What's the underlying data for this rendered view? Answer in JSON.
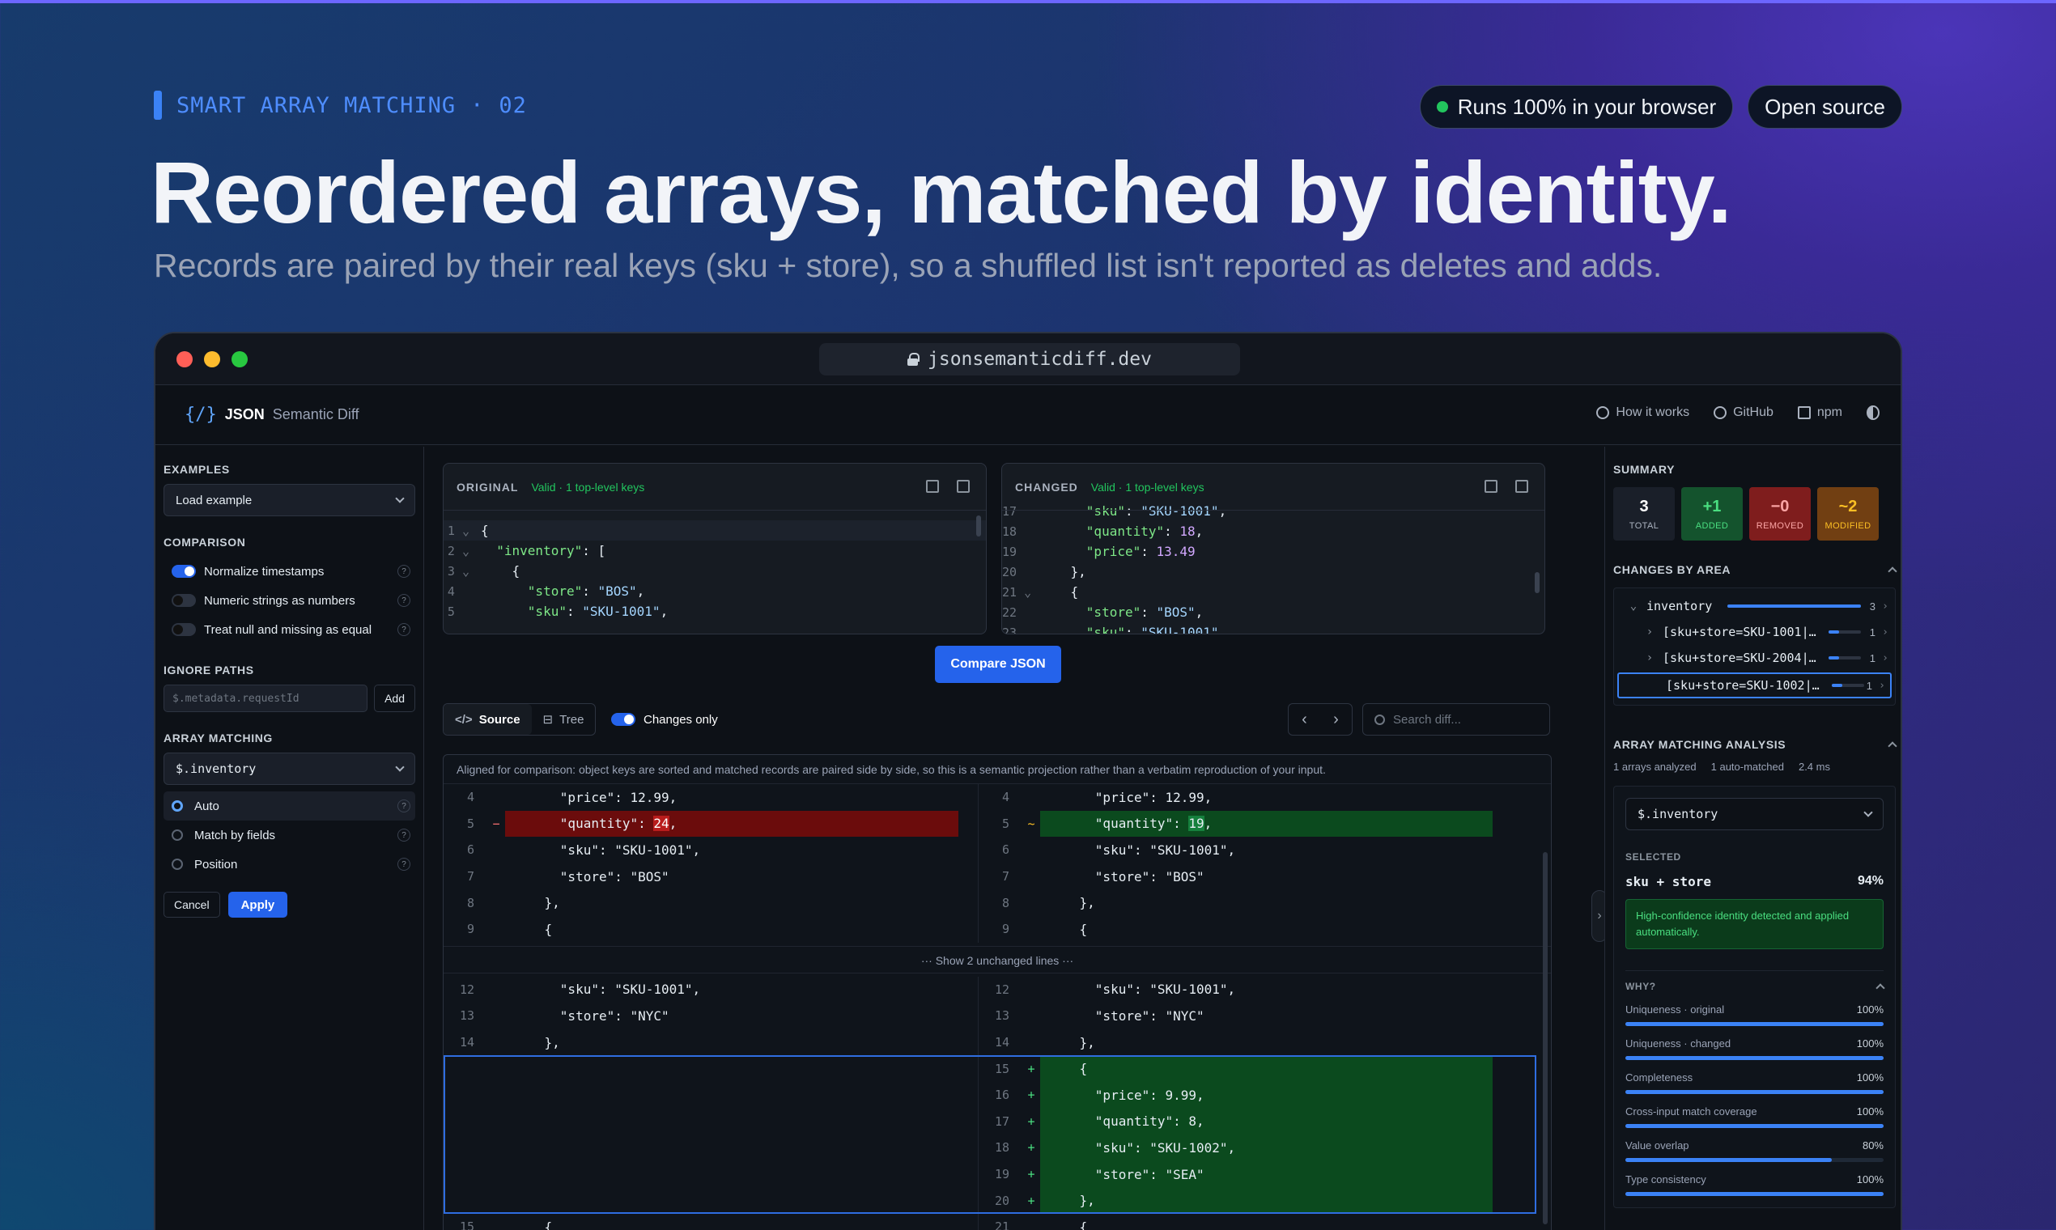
{
  "hero": {
    "eyebrow": "SMART ARRAY MATCHING",
    "eyebrow_sep": "·",
    "eyebrow_num": "02",
    "pill_browser": "Runs 100% in your browser",
    "pill_open": "Open source",
    "title": "Reordered arrays, matched by identity.",
    "subtitle": "Records are paired by their real keys (sku + store), so a shuffled list isn't reported as deletes and adds."
  },
  "window": {
    "url": "jsonsemanticdiff.dev"
  },
  "app": {
    "brand_bracket": "{/}",
    "brand_bold": "JSON",
    "brand_rest": "Semantic Diff",
    "nav": {
      "how": "How it works",
      "github": "GitHub",
      "npm": "npm"
    }
  },
  "sidebar": {
    "examples_label": "EXAMPLES",
    "examples_value": "Load example",
    "comparison_label": "COMPARISON",
    "toggles": [
      {
        "label": "Normalize timestamps",
        "on": true
      },
      {
        "label": "Numeric strings as numbers",
        "on": false
      },
      {
        "label": "Treat null and missing as equal",
        "on": false
      }
    ],
    "help": "?",
    "ignore_label": "IGNORE PATHS",
    "ignore_placeholder": "$.metadata.requestId",
    "add_label": "Add",
    "array_label": "ARRAY MATCHING",
    "array_value": "$.inventory",
    "radios": [
      {
        "label": "Auto",
        "selected": true
      },
      {
        "label": "Match by fields",
        "selected": false
      },
      {
        "label": "Position",
        "selected": false
      }
    ],
    "cancel": "Cancel",
    "apply": "Apply"
  },
  "editors": {
    "original": {
      "label": "ORIGINAL",
      "status": "Valid · 1 top-level keys",
      "lines": [
        {
          "n": "1",
          "fold": true,
          "t": "{"
        },
        {
          "n": "2",
          "fold": true,
          "t": "  \"inventory\": ["
        },
        {
          "n": "3",
          "fold": true,
          "t": "    {"
        },
        {
          "n": "4",
          "fold": false,
          "t": "      \"store\": \"BOS\","
        },
        {
          "n": "5",
          "fold": false,
          "t": "      \"sku\": \"SKU-1001\","
        }
      ]
    },
    "changed": {
      "label": "CHANGED",
      "status": "Valid · 1 top-level keys",
      "lines": [
        {
          "n": "17",
          "fold": false,
          "t": "      \"sku\": \"SKU-1001\","
        },
        {
          "n": "18",
          "fold": false,
          "t": "      \"quantity\": 18,"
        },
        {
          "n": "19",
          "fold": false,
          "t": "      \"price\": 13.49"
        },
        {
          "n": "20",
          "fold": false,
          "t": "    },"
        },
        {
          "n": "21",
          "fold": true,
          "t": "    {"
        },
        {
          "n": "22",
          "fold": false,
          "t": "      \"store\": \"BOS\","
        },
        {
          "n": "23",
          "fold": false,
          "t": "      \"sku\": \"SKU-1001\""
        }
      ]
    },
    "compare_button": "Compare JSON"
  },
  "toolbar": {
    "source": "Source",
    "tree": "Tree",
    "changes_only": "Changes only",
    "search_placeholder": "Search diff..."
  },
  "diff": {
    "note": "Aligned for comparison: object keys are sorted and matched records are paired side by side, so this is a semantic projection rather than a verbatim reproduction of your input.",
    "gap_label": "··· Show 2 unchanged lines ···",
    "rows_a": [
      {
        "ln": "4",
        "lt": "      \"price\": 12.99,",
        "rn": "4",
        "rt": "      \"price\": 12.99,"
      },
      {
        "ln": "5",
        "lm": "−",
        "lpre": "      \"quantity\": ",
        "lhl": "24",
        "lpost": ",",
        "rn": "5",
        "rm": "~",
        "rpre": "      \"quantity\": ",
        "rhl": "19",
        "rpost": ","
      },
      {
        "ln": "6",
        "lt": "      \"sku\": \"SKU-1001\",",
        "rn": "6",
        "rt": "      \"sku\": \"SKU-1001\","
      },
      {
        "ln": "7",
        "lt": "      \"store\": \"BOS\"",
        "rn": "7",
        "rt": "      \"store\": \"BOS\""
      },
      {
        "ln": "8",
        "lt": "    },",
        "rn": "8",
        "rt": "    },"
      },
      {
        "ln": "9",
        "lt": "    {",
        "rn": "9",
        "rt": "    {"
      }
    ],
    "rows_b": [
      {
        "ln": "12",
        "lt": "      \"sku\": \"SKU-1001\",",
        "rn": "12",
        "rt": "      \"sku\": \"SKU-1001\","
      },
      {
        "ln": "13",
        "lt": "      \"store\": \"NYC\"",
        "rn": "13",
        "rt": "      \"store\": \"NYC\""
      },
      {
        "ln": "14",
        "lt": "    },",
        "rn": "14",
        "rt": "    },"
      },
      {
        "rn": "15",
        "rm": "+",
        "rt": "    {",
        "add": true
      },
      {
        "rn": "16",
        "rm": "+",
        "rt": "      \"price\": 9.99,",
        "add": true
      },
      {
        "rn": "17",
        "rm": "+",
        "rt": "      \"quantity\": 8,",
        "add": true
      },
      {
        "rn": "18",
        "rm": "+",
        "rt": "      \"sku\": \"SKU-1002\",",
        "add": true
      },
      {
        "rn": "19",
        "rm": "+",
        "rt": "      \"store\": \"SEA\"",
        "add": true
      },
      {
        "rn": "20",
        "rm": "+",
        "rt": "    },",
        "add": true
      },
      {
        "ln": "15",
        "lt": "    {",
        "rn": "21",
        "rt": "    {"
      }
    ]
  },
  "summary": {
    "label": "SUMMARY",
    "total": "3",
    "total_label": "TOTAL",
    "added": "+1",
    "added_label": "ADDED",
    "removed": "−0",
    "removed_label": "REMOVED",
    "modified": "~2",
    "modified_label": "MODIFIED"
  },
  "changes_by_area": {
    "label": "CHANGES BY AREA",
    "rows": [
      {
        "name": "inventory",
        "count": "3",
        "fill": 1.0,
        "level": 0,
        "open": true
      },
      {
        "name": "[sku+store=SKU-1001|…",
        "count": "1",
        "fill": 0.33,
        "level": 1
      },
      {
        "name": "[sku+store=SKU-2004|…",
        "count": "1",
        "fill": 0.33,
        "level": 1
      },
      {
        "name": "[sku+store=SKU-1002|…",
        "count": "1",
        "fill": 0.33,
        "level": 1,
        "selected": true
      }
    ]
  },
  "array_analysis": {
    "label": "ARRAY MATCHING ANALYSIS",
    "meta1": "1 arrays analyzed",
    "meta2": "1 auto-matched",
    "meta3": "2.4 ms",
    "select_value": "$.inventory",
    "selected_label": "SELECTED",
    "selected_key": "sku + store",
    "selected_pct": "94%",
    "confidence_text": "High-confidence identity detected and applied automatically.",
    "why_label": "WHY?",
    "metrics": [
      {
        "label": "Uniqueness · original",
        "value": "100%",
        "fill": 1.0
      },
      {
        "label": "Uniqueness · changed",
        "value": "100%",
        "fill": 1.0
      },
      {
        "label": "Completeness",
        "value": "100%",
        "fill": 1.0
      },
      {
        "label": "Cross-input match coverage",
        "value": "100%",
        "fill": 1.0
      },
      {
        "label": "Value overlap",
        "value": "80%",
        "fill": 0.8
      },
      {
        "label": "Type consistency",
        "value": "100%",
        "fill": 1.0
      }
    ]
  }
}
